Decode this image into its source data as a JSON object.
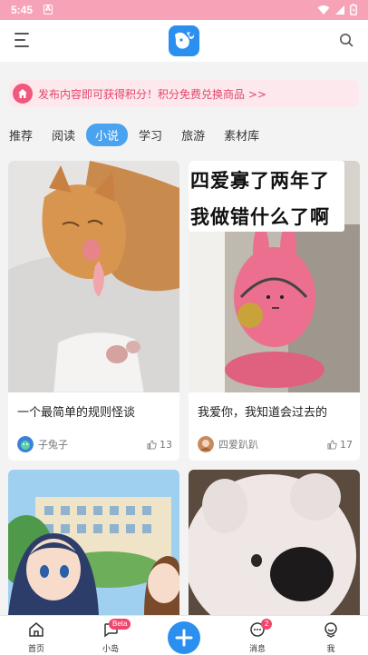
{
  "status_bar": {
    "time": "5:45",
    "notif_icon": "A"
  },
  "banner": {
    "text": "发布内容即可获得积分！积分免费兑换商品 >>"
  },
  "tabs": [
    "推荐",
    "阅读",
    "小说",
    "学习",
    "旅游",
    "素材库"
  ],
  "active_tab": "小说",
  "cards": [
    {
      "title": "一个最简单的规则怪谈",
      "author": "子兔子",
      "likes": "13",
      "image": "cat-photo"
    },
    {
      "title": "我爱你，我知道会过去的",
      "author": "四爱趴趴",
      "likes": "17",
      "image": "pink-plush-photo",
      "image_caption_lines": [
        "四爱寡了两年了",
        "我做错什么了啊"
      ]
    },
    {
      "image": "anime-school-illustration"
    },
    {
      "image": "white-plush-dog-photo"
    }
  ],
  "bottom_nav": {
    "home": "首页",
    "island": "小岛",
    "island_badge": "Beta",
    "messages": "消息",
    "messages_badge": "2",
    "me": "我"
  },
  "colors": {
    "accent": "#2b8ff0",
    "status_bar": "#f6a3b8",
    "banner_bg": "#fde8ee",
    "banner_text": "#e3456a",
    "tab_active": "#4aa3ee"
  }
}
